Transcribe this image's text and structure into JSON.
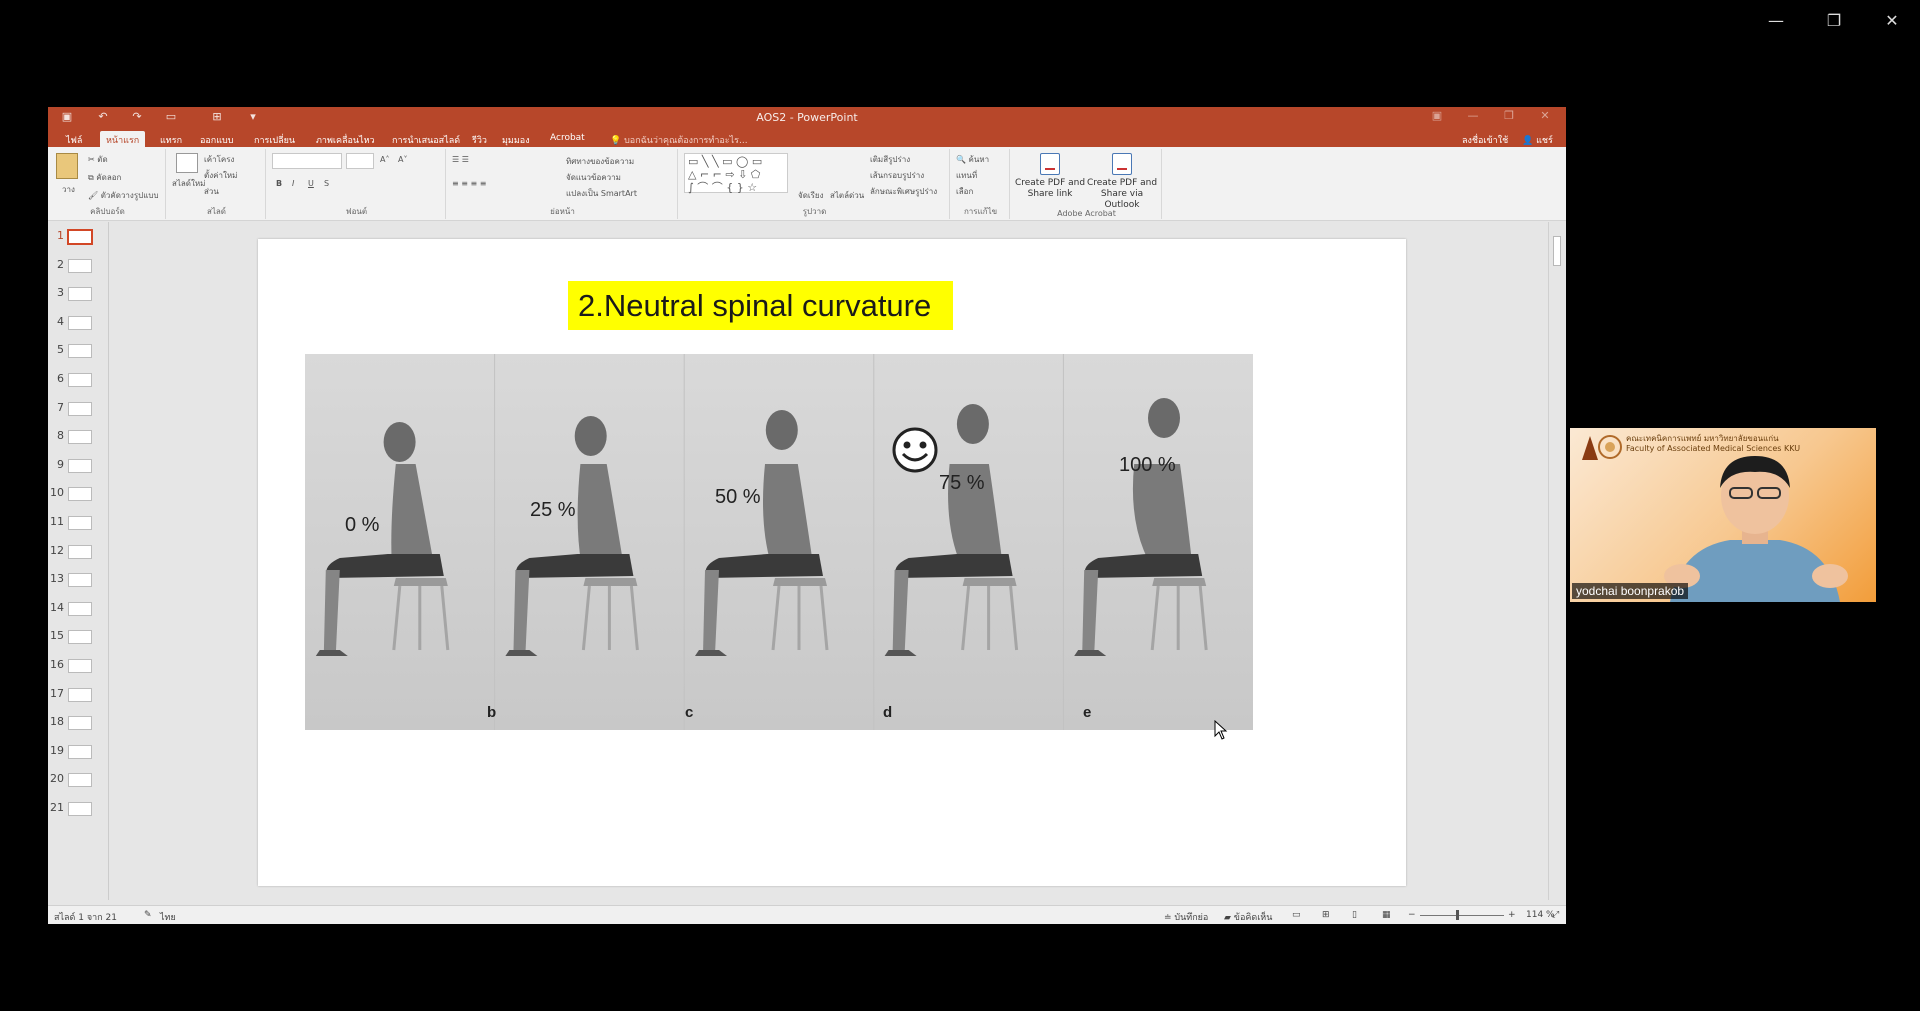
{
  "outer_window": {
    "minimize": "—",
    "restore": "❐",
    "close": "✕"
  },
  "app": {
    "title": "AOS2 - PowerPoint"
  },
  "qat": {
    "save": "▣",
    "undo": "↶",
    "redo": "↷",
    "present": "▭",
    "more": "⊞",
    "dropdown": "▾"
  },
  "title_controls": {
    "ribbon_display": "▣",
    "minimize": "—",
    "restore": "❐",
    "close": "✕"
  },
  "tabs": [
    {
      "label": "ไฟล์"
    },
    {
      "label": "หน้าแรก"
    },
    {
      "label": "แทรก"
    },
    {
      "label": "ออกแบบ"
    },
    {
      "label": "การเปลี่ยน"
    },
    {
      "label": "ภาพเคลื่อนไหว"
    },
    {
      "label": "การนำเสนอสไลด์"
    },
    {
      "label": "รีวิว"
    },
    {
      "label": "มุมมอง"
    },
    {
      "label": "Acrobat"
    }
  ],
  "tell_me": "บอกฉันว่าคุณต้องการทำอะไร...",
  "account": {
    "signin": "ลงชื่อเข้าใช้",
    "share": "แชร์"
  },
  "ribbon": {
    "clipboard": {
      "paste": "วาง",
      "cut": "ตัด",
      "copy": "คัดลอก",
      "format_painter": "ตัวคัดวางรูปแบบ",
      "label": "คลิปบอร์ด"
    },
    "slides": {
      "new_slide": "สไลด์ใหม่",
      "layout": "เค้าโครง",
      "reset": "ตั้งค่าใหม่",
      "section": "ส่วน",
      "label": "สไลด์"
    },
    "font": {
      "label": "ฟอนต์",
      "bold": "B",
      "italic": "I",
      "underline": "U",
      "strike": "S"
    },
    "paragraph": {
      "label": "ย่อหน้า",
      "text_direction": "ทิศทางของข้อความ",
      "align_text": "จัดแนวข้อความ",
      "smartart": "แปลงเป็น SmartArt"
    },
    "drawing": {
      "arrange": "จัดเรียง",
      "quick_styles": "สไตล์ด่วน",
      "shape_fill": "เติมสีรูปร่าง",
      "shape_outline": "เส้นกรอบรูปร่าง",
      "shape_effects": "ลักษณะพิเศษรูปร่าง",
      "label": "รูปวาด"
    },
    "editing": {
      "find": "ค้นหา",
      "replace": "แทนที่",
      "select": "เลือก",
      "label": "การแก้ไข"
    },
    "acrobat": {
      "create_share": "Create PDF and Share link",
      "create_outlook": "Create PDF and Share via Outlook",
      "label": "Adobe Acrobat"
    }
  },
  "thumbnails": [
    "1",
    "2",
    "3",
    "4",
    "5",
    "6",
    "7",
    "8",
    "9",
    "10",
    "11",
    "12",
    "13",
    "14",
    "15",
    "16",
    "17",
    "18",
    "19",
    "20",
    "21"
  ],
  "active_slide": 1,
  "slide": {
    "title": "2.Neutral spinal curvature",
    "figures": [
      {
        "percent": "0 %",
        "letter": ""
      },
      {
        "percent": "25 %",
        "letter": "b"
      },
      {
        "percent": "50 %",
        "letter": "c"
      },
      {
        "percent": "75 %",
        "letter": "d"
      },
      {
        "percent": "100 %",
        "letter": "e"
      }
    ]
  },
  "status": {
    "slide_count": "สไลด์ 1 จาก 21",
    "language": "ไทย",
    "notes": "บันทึกย่อ",
    "comments": "ข้อคิดเห็น",
    "zoom": "114 %"
  },
  "webcam": {
    "org_line1": "คณะเทคนิคการแพทย์ มหาวิทยาลัยขอนแก่น",
    "org_line2": "Faculty of Associated Medical Sciences KKU",
    "name": "yodchai boonprakob"
  },
  "colors": {
    "accent": "#b7472a",
    "title_highlight": "#ffff00"
  }
}
